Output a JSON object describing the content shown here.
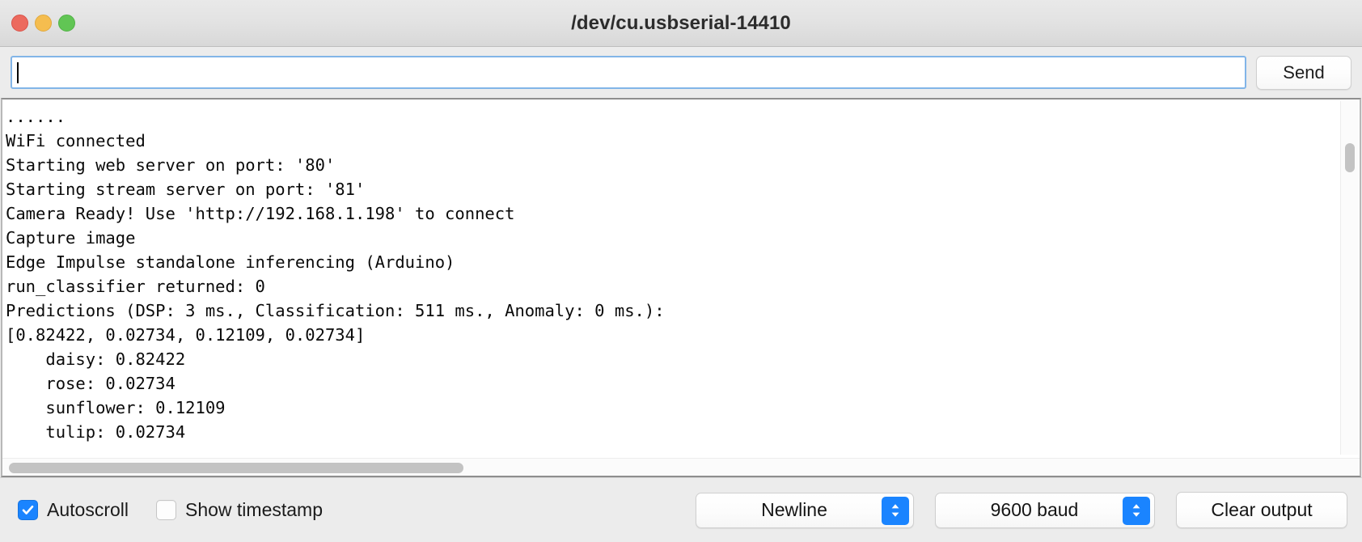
{
  "window": {
    "title": "/dev/cu.usbserial-14410",
    "traffic_lights": [
      {
        "name": "close",
        "color": "#ec6a5e"
      },
      {
        "name": "minimize",
        "color": "#f5bd4f"
      },
      {
        "name": "maximize",
        "color": "#61c554"
      }
    ]
  },
  "send_bar": {
    "input_value": "",
    "input_placeholder": "",
    "send_label": "Send",
    "focus_ring_color": "#82b5e8"
  },
  "console": {
    "lines": [
      "......",
      "WiFi connected",
      "Starting web server on port: '80'",
      "Starting stream server on port: '81'",
      "Camera Ready! Use 'http://192.168.1.198' to connect",
      "Capture image",
      "Edge Impulse standalone inferencing (Arduino)",
      "run_classifier returned: 0",
      "Predictions (DSP: 3 ms., Classification: 511 ms., Anomaly: 0 ms.):",
      "[0.82422, 0.02734, 0.12109, 0.02734]",
      "    daisy: 0.82422",
      "    rose: 0.02734",
      "    sunflower: 0.12109",
      "    tulip: 0.02734"
    ]
  },
  "bottom_bar": {
    "autoscroll": {
      "label": "Autoscroll",
      "checked": true
    },
    "show_timestamp": {
      "label": "Show timestamp",
      "checked": false
    },
    "line_ending": {
      "selected": "Newline"
    },
    "baud_rate": {
      "selected": "9600 baud"
    },
    "clear_output_label": "Clear output",
    "accent_color": "#1a84ff"
  }
}
